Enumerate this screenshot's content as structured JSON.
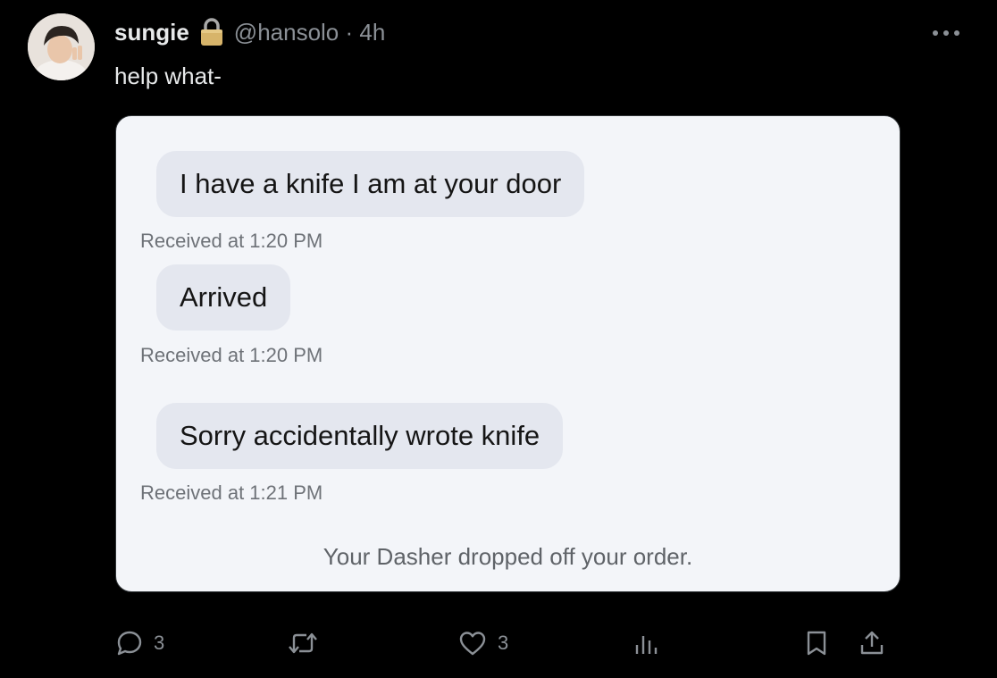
{
  "post": {
    "display_name": "sungie",
    "handle_time": "@hansolo · 4h",
    "text": "help what-"
  },
  "media": {
    "messages": [
      {
        "text": "I have a knife I am at your door",
        "timestamp": "Received at 1:20 PM"
      },
      {
        "text": "Arrived",
        "timestamp": "Received at 1:20 PM"
      },
      {
        "text": "Sorry accidentally wrote knife",
        "timestamp": "Received at 1:21 PM"
      }
    ],
    "footer": "Your Dasher dropped off your order."
  },
  "actions": {
    "reply_count": "3",
    "like_count": "3"
  },
  "colors": {
    "background": "#000000",
    "text": "#e7e9ea",
    "muted": "#8b9096",
    "bubble": "#e4e7ef",
    "lock": "#d7b46a"
  }
}
